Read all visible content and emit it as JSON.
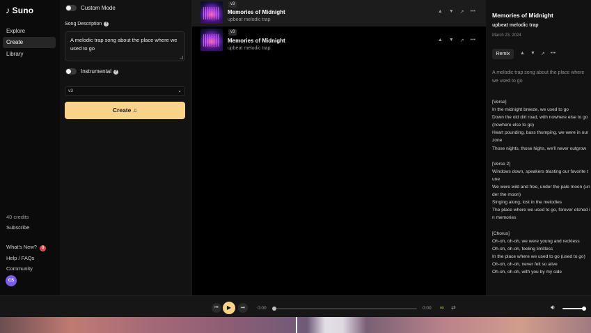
{
  "brand": {
    "name": "Suno"
  },
  "nav": [
    {
      "label": "Explore"
    },
    {
      "label": "Create"
    },
    {
      "label": "Library"
    }
  ],
  "account": {
    "credits": "40 credits",
    "subscribe": "Subscribe",
    "whats_new": "What's New?",
    "whats_new_badge": "8",
    "help": "Help / FAQs",
    "community": "Community",
    "avatar_initials": "CS"
  },
  "create_panel": {
    "custom_mode_label": "Custom Mode",
    "song_description_label": "Song Description",
    "song_description_value": "A melodic trap song about the place where we used to go",
    "instrumental_label": "Instrumental",
    "model_version": "v3",
    "create_button": "Create",
    "create_icon": "♫"
  },
  "songs": [
    {
      "version": "v3",
      "title": "Memories of Midnight",
      "tags": "upbeat melodic trap"
    },
    {
      "version": "v3",
      "title": "Memories of Midnight",
      "tags": "upbeat melodic trap"
    }
  ],
  "details": {
    "title": "Memories of Midnight",
    "tags": "upbeat melodic trap",
    "date": "March 23, 2024",
    "remix_button": "Remix",
    "prompt": "A melodic trap song about the place where we used to go",
    "lyrics": "[Verse]\nIn the midnight breeze, we used to go\nDown the old dirt road, with nowhere else to go (nowhere else to go)\nHeart pounding, bass thumping, we were in our zone\nThose nights, those highs, we'll never outgrow\n\n[Verse 2]\nWindows down, speakers blasting our favorite tune\nWe were wild and free, under the pale moon (under the moon)\nSinging along, lost in the melodies\nThe place where we used to go, forever etched in memories\n\n[Chorus]\nOh-oh, oh-oh, we were young and reckless\nOh-oh, oh-oh, feeling limitless\nIn the place where we used to go (used to go)\nOh-oh, oh-oh, never felt so alive\nOh-oh, oh-oh, with you by my side"
  },
  "player": {
    "current_time": "0:00",
    "total_time": "0:00",
    "progress": 0,
    "volume": 1.0
  },
  "icons": {
    "thumbs_up": "thumbs-up-icon",
    "thumbs_down": "thumbs-down-icon",
    "share": "share-icon",
    "more": "more-icon"
  },
  "colors": {
    "accent": "#f9d38a",
    "badge": "#e0484d",
    "loop_active": "#b9d84a",
    "avatar": "#7b5cf0"
  }
}
